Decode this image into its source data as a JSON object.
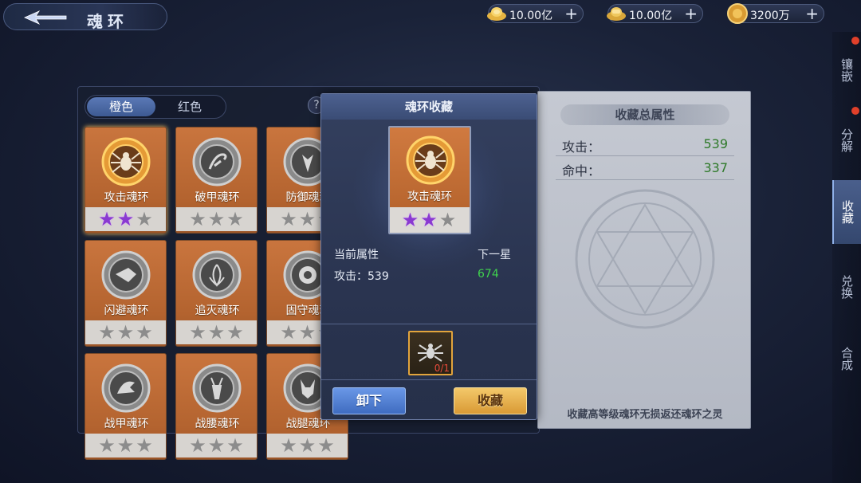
{
  "header": {
    "title": "魂环",
    "currencies": [
      {
        "icon": "gold-ingot-icon",
        "amount": "10.00亿"
      },
      {
        "icon": "silver-ingot-icon",
        "amount": "10.00亿"
      },
      {
        "icon": "gold-coin-icon",
        "amount": "3200万"
      }
    ],
    "plus_symbol": "+"
  },
  "sidebar": {
    "items": [
      {
        "label": "镶嵌",
        "active": false,
        "badge": true
      },
      {
        "label": "分解",
        "active": false,
        "badge": true
      },
      {
        "label": "收藏",
        "active": true,
        "badge": false
      },
      {
        "label": "兑换",
        "active": false,
        "badge": false
      },
      {
        "label": "合成",
        "active": false,
        "badge": false
      }
    ]
  },
  "grid": {
    "tabs": [
      {
        "label": "橙色",
        "active": true
      },
      {
        "label": "红色",
        "active": false
      }
    ],
    "help_label": "?",
    "cards": [
      {
        "name": "攻击魂环",
        "stars": 2,
        "max_stars": 3,
        "selected": true
      },
      {
        "name": "破甲魂环",
        "stars": 0,
        "max_stars": 3
      },
      {
        "name": "防御魂环",
        "stars": 0,
        "max_stars": 3
      },
      {
        "name": "闪避魂环",
        "stars": 0,
        "max_stars": 3
      },
      {
        "name": "追灭魂环",
        "stars": 0,
        "max_stars": 3
      },
      {
        "name": "固守魂环",
        "stars": 0,
        "max_stars": 3
      },
      {
        "name": "战甲魂环",
        "stars": 0,
        "max_stars": 3
      },
      {
        "name": "战腰魂环",
        "stars": 0,
        "max_stars": 3
      },
      {
        "name": "战腿魂环",
        "stars": 0,
        "max_stars": 3
      }
    ]
  },
  "stats_panel": {
    "title": "收藏总属性",
    "stats": [
      {
        "label": "攻击：",
        "value": "539"
      },
      {
        "label": "命中：",
        "value": "337"
      }
    ],
    "footer": "收藏高等级魂环无损返还魂环之灵"
  },
  "popup": {
    "title": "魂环收藏",
    "card": {
      "name": "攻击魂环",
      "stars": 2,
      "max_stars": 3
    },
    "current_label": "当前属性",
    "next_label": "下一星",
    "current_value": "攻击：539",
    "next_value": "674",
    "material_qty": "0/1",
    "unequip_label": "卸下",
    "collect_label": "收藏"
  },
  "colors": {
    "accent_blue": "#3f6cc0",
    "accent_gold": "#d99a35",
    "orange_card": "#c9753e",
    "star_active": "#8a3ad1",
    "stat_green": "#2f7a2a"
  }
}
